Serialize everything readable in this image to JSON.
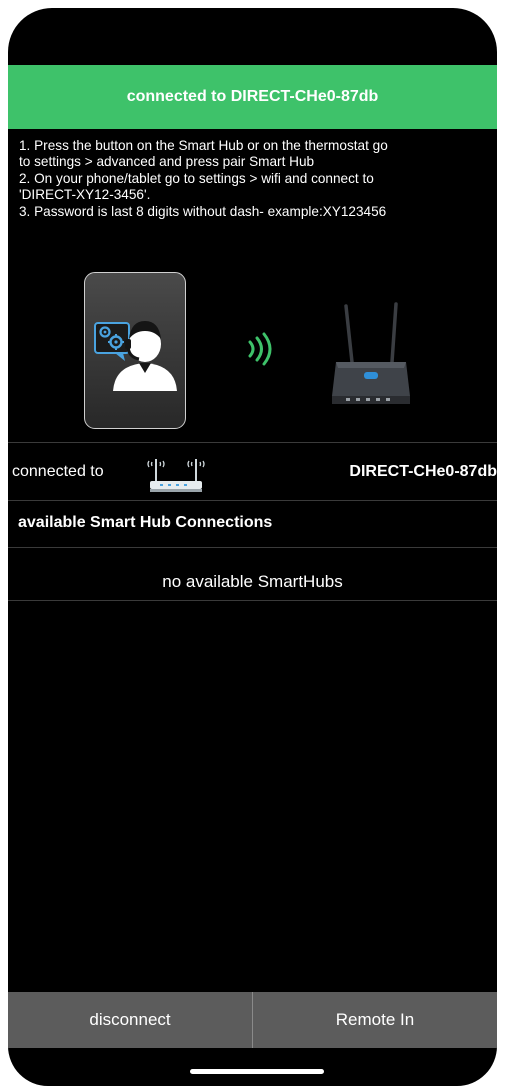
{
  "banner": {
    "text": "connected to DIRECT-CHe0-87db"
  },
  "instructions": [
    "1. Press the button on the Smart Hub or on the thermostat go",
    "to settings > advanced and press pair Smart Hub",
    "2. On your phone/tablet go to settings > wifi and connect to",
    "'DIRECT-XY12-3456'.",
    "3. Password is last 8 digits without dash- example:XY123456"
  ],
  "illustration": {
    "left_icon": "user-settings-icon",
    "middle_icon": "wifi-signal-icon",
    "right_icon": "router-icon"
  },
  "connection": {
    "label": "connected to",
    "icon": "router-icon",
    "network": "DIRECT-CHe0-87db"
  },
  "available": {
    "title": "available Smart Hub Connections",
    "empty_text": "no available SmartHubs"
  },
  "buttons": {
    "disconnect": "disconnect",
    "remote_in": "Remote In"
  },
  "colors": {
    "banner": "#3ec26a",
    "background": "#000000",
    "button_bar": "#5c5c5c",
    "wifi_signal": "#3ec26a"
  }
}
